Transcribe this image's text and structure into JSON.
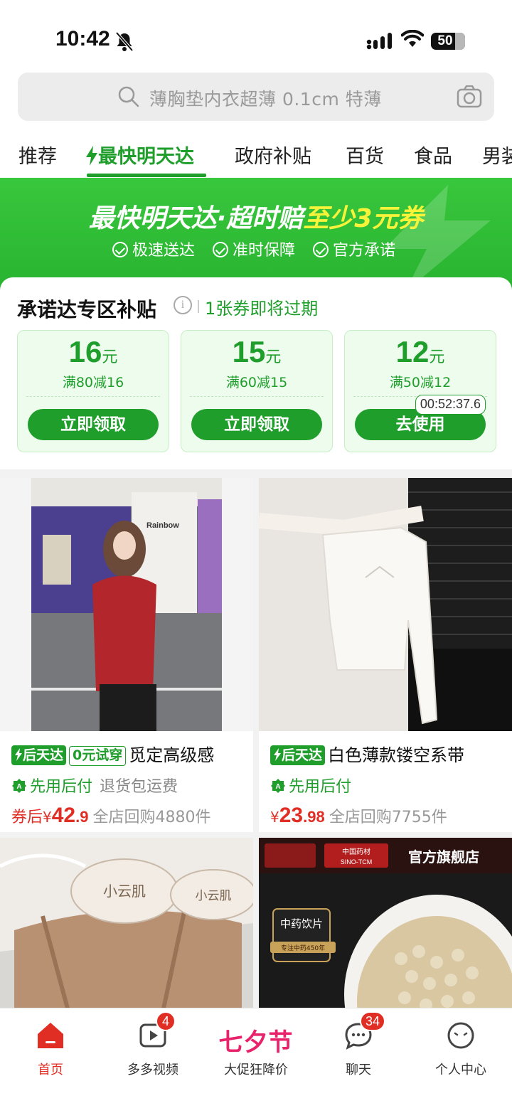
{
  "status": {
    "time": "10:42",
    "battery": "50"
  },
  "search": {
    "placeholder": "薄胸垫内衣超薄 0.1cm 特薄"
  },
  "tabs": [
    {
      "label": "推荐"
    },
    {
      "label": "最快明天达"
    },
    {
      "label": "政府补贴"
    },
    {
      "label": "百货"
    },
    {
      "label": "食品"
    },
    {
      "label": "男装"
    }
  ],
  "banner": {
    "title_main": "最快明天达·超时赔",
    "title_highlight": "至少3元券",
    "promises": [
      "极速送达",
      "准时保障",
      "官方承诺"
    ]
  },
  "coupons": {
    "title": "承诺达专区补贴",
    "expiry_note": "1张券即将过期",
    "items": [
      {
        "amount": "16",
        "unit": "元",
        "condition": "满80减16",
        "button": "立即领取"
      },
      {
        "amount": "15",
        "unit": "元",
        "condition": "满60减15",
        "button": "立即领取"
      },
      {
        "amount": "12",
        "unit": "元",
        "condition": "满50减12",
        "button": "去使用",
        "timer": "00:52:37.6"
      }
    ]
  },
  "products": [
    {
      "tag1": "后天达",
      "tag2": "0元试穿",
      "title": "觅定高级感",
      "pay": "先用后付",
      "returns": "退货包运费",
      "price_prefix": "券后",
      "currency": "¥",
      "price_int": "42",
      "price_dec": ".9",
      "sold": "全店回购4880件"
    },
    {
      "tag1": "后天达",
      "title": "白色薄款镂空系带",
      "pay": "先用后付",
      "currency": "¥",
      "price_int": "23",
      "price_dec": ".98",
      "sold": "全店回购7755件"
    },
    {
      "image_text": [
        "小云肌",
        "小云肌"
      ]
    },
    {
      "image_text": [
        "官方旗舰店",
        "中药饮片",
        "专注中药450年",
        "中国药材",
        "SINO-TCM"
      ]
    }
  ],
  "photo_text": {
    "storefront": "Rainbow"
  },
  "nav": [
    {
      "label": "首页"
    },
    {
      "label": "多多视频",
      "badge": "4"
    },
    {
      "label": "大促狂降价",
      "festival": "七夕节"
    },
    {
      "label": "聊天",
      "badge": "34"
    },
    {
      "label": "个人中心"
    }
  ],
  "colors": {
    "accent_green": "#1f9e2c",
    "price_red": "#e02e24",
    "festival_pink": "#e8236b"
  }
}
